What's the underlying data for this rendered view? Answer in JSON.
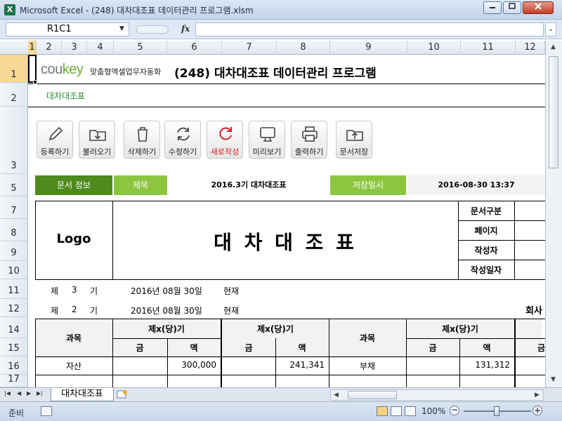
{
  "window": {
    "title": "Microsoft Excel - (248) 대차대조표 데이터관리 프로그램.xlsm",
    "app_icon": "X"
  },
  "formula_bar": {
    "name_box": "R1C1",
    "fx": "fx",
    "formula": ""
  },
  "columns": [
    "1",
    "2",
    "3",
    "4",
    "5",
    "6",
    "7",
    "8",
    "9",
    "10",
    "11",
    "12"
  ],
  "rows": [
    "1",
    "2",
    "3",
    "5",
    "7",
    "8",
    "9",
    "10",
    "11",
    "12",
    "14",
    "15",
    "16",
    "17"
  ],
  "header": {
    "logo_co": "cou",
    "logo_key": "key",
    "logo_tagline": "맞춤형엑셀업무자동화",
    "title": "(248) 대차대조표 데이터관리 프로그램",
    "subtitle": "대차대조표"
  },
  "toolbar": [
    {
      "label": "등록하기",
      "icon": "pencil-icon"
    },
    {
      "label": "불러오기",
      "icon": "download-folder-icon"
    },
    {
      "label": "삭제하기",
      "icon": "trash-icon"
    },
    {
      "label": "수정하기",
      "icon": "refresh-icon"
    },
    {
      "label": "새로작성",
      "icon": "new-document-icon"
    },
    {
      "label": "미리보기",
      "icon": "monitor-icon"
    },
    {
      "label": "출력하기",
      "icon": "printer-icon"
    },
    {
      "label": "문서저장",
      "icon": "upload-folder-icon"
    }
  ],
  "doc_info": {
    "label": "문서 정보",
    "title_label": "제목",
    "title_value": "2016.3기 대차대조표",
    "date_label": "저장일시",
    "date_value": "2016-08-30 13:37"
  },
  "form": {
    "logo": "Logo",
    "doc_title": "대 차 대 조 표",
    "meta_labels": [
      "문서구분",
      "페이지",
      "작성자",
      "작성일자"
    ],
    "period_lines": [
      {
        "prefix": "제",
        "num": "3",
        "suffix": "기",
        "date": "2016년 08월 30일",
        "note": "현재"
      },
      {
        "prefix": "제",
        "num": "2",
        "suffix": "기",
        "date": "2016년 08월 30일",
        "note": "현재"
      }
    ],
    "company_label": "회사"
  },
  "table": {
    "subject_header": "과목",
    "period_header": "제x(당)기",
    "amount_left": "금",
    "amount_right": "액",
    "rows": [
      {
        "left_subject": "자산",
        "left_current": "300,000",
        "left_prev": "241,341",
        "right_subject": "부채",
        "right_current": "131,312"
      }
    ]
  },
  "sheet_tabs": {
    "active": "대차대조표"
  },
  "status": {
    "ready": "준비",
    "zoom": "100%",
    "zoom_level_pct": 50
  },
  "colors": {
    "accent_green": "#4e8a1c",
    "light_green": "#8cc63f",
    "selection": "#f9d794",
    "excel_green": "#1f7145"
  }
}
